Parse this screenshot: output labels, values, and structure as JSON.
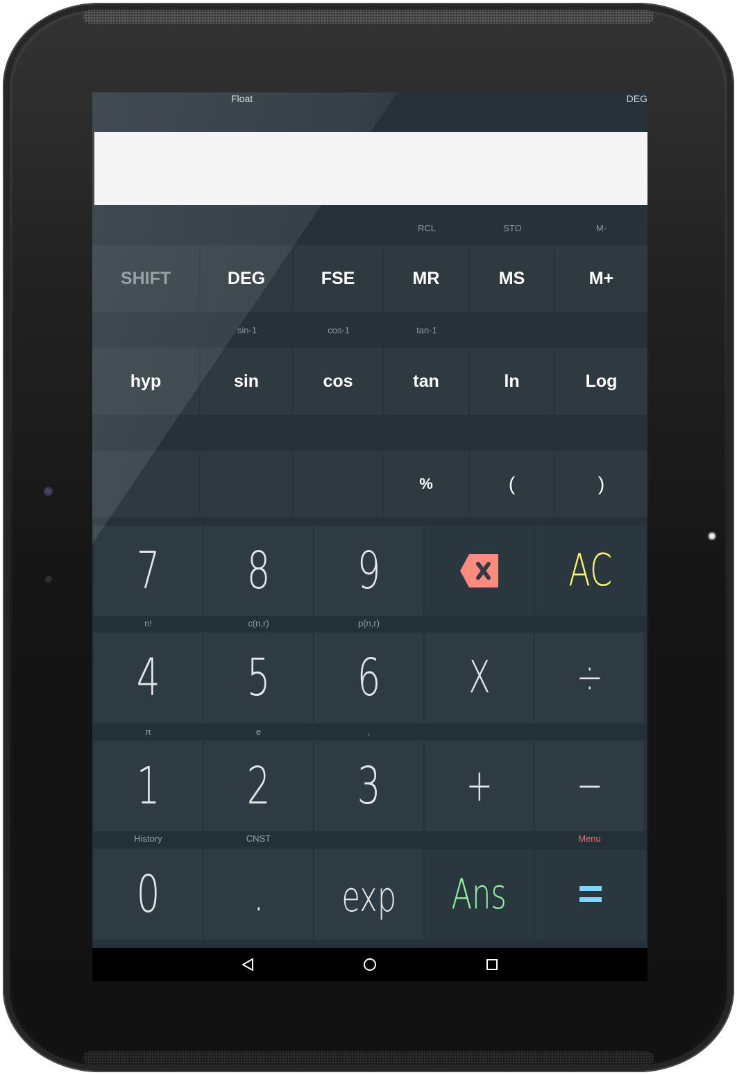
{
  "status": {
    "mode_left": "Float",
    "mode_right": "DEG"
  },
  "display": {
    "value": ""
  },
  "function_rows": [
    {
      "hints": [
        "",
        "",
        "",
        "RCL",
        "STO",
        "M-"
      ],
      "keys": [
        "SHIFT",
        "DEG",
        "FSE",
        "MR",
        "MS",
        "M+"
      ]
    },
    {
      "hints": [
        "",
        "sin-1",
        "cos-1",
        "tan-1",
        "",
        ""
      ],
      "keys": [
        "hyp",
        "sin",
        "cos",
        "tan",
        "ln",
        "Log"
      ]
    },
    {
      "hints": [
        "",
        "",
        "",
        "",
        "",
        ""
      ],
      "keys": [
        "",
        "",
        "",
        "%",
        "(",
        ")"
      ]
    }
  ],
  "number_rows": [
    {
      "keys": [
        "7",
        "8",
        "9",
        "backspace",
        "AC"
      ],
      "hints": [
        "n!",
        "c(n,r)",
        "p(n,r)",
        "",
        ""
      ]
    },
    {
      "keys": [
        "4",
        "5",
        "6",
        "X",
        "÷"
      ],
      "hints": [
        "π",
        "e",
        ",",
        "",
        ""
      ]
    },
    {
      "keys": [
        "1",
        "2",
        "3",
        "+",
        "−"
      ],
      "hints": [
        "History",
        "CNST",
        "",
        "",
        "Menu"
      ]
    },
    {
      "keys": [
        "0",
        ".",
        "exp",
        "Ans",
        "="
      ],
      "hints": []
    }
  ],
  "colors": {
    "ac": "#fff176",
    "backspace": "#ff8a80",
    "ans": "#8ef3a0",
    "equals": "#81d4fa",
    "menu_hint": "#e57373"
  },
  "navbar": {
    "back": "back-icon",
    "home": "home-icon",
    "recents": "recents-icon"
  }
}
